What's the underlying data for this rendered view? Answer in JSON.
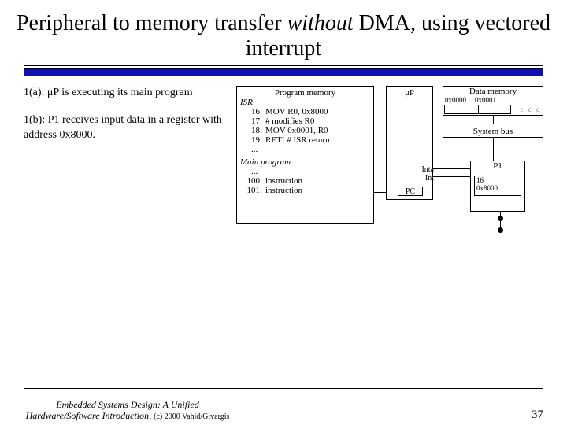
{
  "title_pre": "Peripheral to memory transfer ",
  "title_italic": "without",
  "title_post": " DMA, using vectored interrupt",
  "steps": {
    "a": "1(a): μP is executing its main program",
    "b": "1(b): P1 receives input data in a register with address 0x8000."
  },
  "progmem": {
    "title": "Program memory",
    "isr_label": "ISR",
    "lines": [
      {
        "n": "16:",
        "t": "MOV R0, 0x8000"
      },
      {
        "n": "17:",
        "t": "# modifies R0"
      },
      {
        "n": "18:",
        "t": "MOV 0x0001, R0"
      },
      {
        "n": "19:",
        "t": "RETI  # ISR return"
      }
    ],
    "dots": "...",
    "main_label": "Main program",
    "main_dots": "...",
    "main_lines": [
      {
        "n": "100:",
        "t": "instruction"
      },
      {
        "n": "101:",
        "t": "instruction"
      }
    ]
  },
  "uP": {
    "label": "μP",
    "inta": "Inta",
    "int": "Int",
    "pc": "PC"
  },
  "datamem": {
    "title": "Data memory",
    "addr0": "0x0000",
    "addr1": "0x0001"
  },
  "sysbus": "System bus",
  "p1": {
    "label": "P1",
    "line1": "16",
    "line2": "0x8000"
  },
  "footer": {
    "book": "Embedded Systems Design: A Unified Hardware/Software Introduction,",
    "copy": "(c) 2000 Vahid/Givargis",
    "page": "37"
  }
}
